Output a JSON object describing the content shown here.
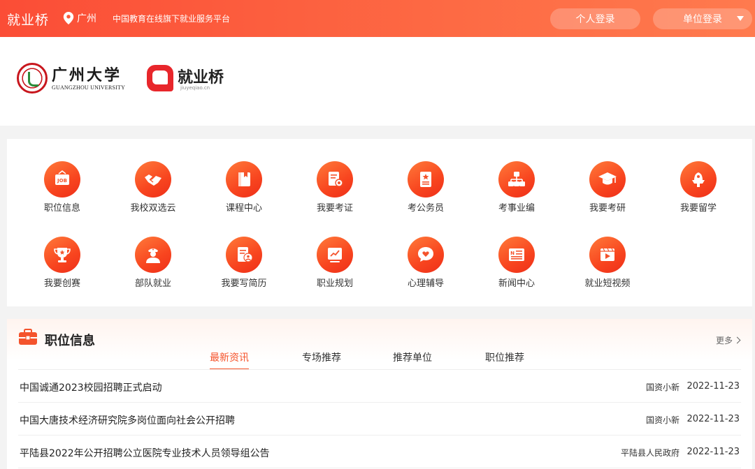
{
  "topbar": {
    "brand": "就业桥",
    "city": "广州",
    "slogan": "中国教育在线旗下就业服务平台",
    "personal_login": "个人登录",
    "unit_login": "单位登录"
  },
  "logos": {
    "university_cn": "广州大学",
    "university_en": "GUANGZHOU UNIVERSITY",
    "platform_cn": "就业桥",
    "platform_url": "jiuyeqiao.cn"
  },
  "services": [
    {
      "label": "职位信息",
      "icon": "job-icon"
    },
    {
      "label": "我校双选云",
      "icon": "handshake-icon"
    },
    {
      "label": "课程中心",
      "icon": "book-icon"
    },
    {
      "label": "我要考证",
      "icon": "certificate-icon"
    },
    {
      "label": "考公务员",
      "icon": "civil-service-icon"
    },
    {
      "label": "考事业编",
      "icon": "org-chart-icon"
    },
    {
      "label": "我要考研",
      "icon": "graduation-cap-icon"
    },
    {
      "label": "我要留学",
      "icon": "study-abroad-icon"
    },
    {
      "label": "我要创赛",
      "icon": "trophy-icon"
    },
    {
      "label": "部队就业",
      "icon": "soldier-icon"
    },
    {
      "label": "我要写简历",
      "icon": "resume-icon"
    },
    {
      "label": "职业规划",
      "icon": "chart-board-icon"
    },
    {
      "label": "心理辅导",
      "icon": "heart-chat-icon"
    },
    {
      "label": "新闻中心",
      "icon": "news-icon"
    },
    {
      "label": "就业短视频",
      "icon": "video-icon"
    }
  ],
  "jobs": {
    "title": "职位信息",
    "more": "更多",
    "tabs": [
      "最新资讯",
      "专场推荐",
      "推荐单位",
      "职位推荐"
    ],
    "active_tab": 0,
    "rows": [
      {
        "title": "中国诚通2023校园招聘正式启动",
        "source": "国资小新",
        "date": "2022-11-23"
      },
      {
        "title": "中国大唐技术经济研究院多岗位面向社会公开招聘",
        "source": "国资小新",
        "date": "2022-11-23"
      },
      {
        "title": "平陆县2022年公开招聘公立医院专业技术人员领导组公告",
        "source": "平陆县人民政府",
        "date": "2022-11-23"
      }
    ]
  },
  "colors": {
    "accent": "#f5532b",
    "topbar_start": "#fb4d36",
    "topbar_end": "#ff7a4e"
  }
}
